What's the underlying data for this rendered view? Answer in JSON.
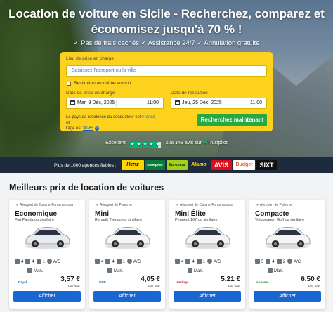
{
  "hero": {
    "title": "Location de voiture en Sicile - Recherchez, comparez et économisez jusqu'à 70 % !",
    "features": "✓ Pas de frais cachés ✓ Assistance 24/7 ✓ Annulation gratuite"
  },
  "form": {
    "pickup_label": "Lieu de prise en charge",
    "pickup_placeholder": "Saisissez l'aéroport ou la ville",
    "same_return_label": "Restitution au même endroit",
    "start_label": "Date de prise en charge",
    "start_date": "Mar, 9 Déc, 2025",
    "start_time": "11:00",
    "end_label": "Date de restitution",
    "end_date": "Jeu, 25 Déc, 2025",
    "end_time": "11:00",
    "residence_text": "Le pays de résidence du conducteur est",
    "residence_country": "France",
    "residence_and": "et",
    "age_text": "l'âge est",
    "age_value": "30-65",
    "search_button": "Recherchez maintenant"
  },
  "trust": {
    "rating_word": "Excellent",
    "reviews": "206 148 avis sur",
    "brand": "Trustpilot",
    "stars": 4.5
  },
  "partners": {
    "label": "Plus de 1000 agences fiables :",
    "brands": [
      "Hertz",
      "Enterprise",
      "Europcar",
      "Alamo",
      "AVIS",
      "Budget",
      "SIXT"
    ]
  },
  "section_title": "Meilleurs prix de location de voitures",
  "cards": [
    {
      "location": "Aéroport de Catane-Fontanarossa",
      "category": "Economique",
      "model": "Fiat Panda ou similaire",
      "seats": "4",
      "doors": "4",
      "bags": "1",
      "ac": "A/C",
      "transmission": "Man.",
      "supplier": "Royal",
      "price": "3,57 €",
      "per": "par jour",
      "button": "Afficher",
      "car_color": "#e8ecef"
    },
    {
      "location": "Aéroport de Palerme",
      "category": "Mini",
      "model": "Renault Twingo ou similaire",
      "seats": "4",
      "doors": "4",
      "bags": "1",
      "ac": "A/C",
      "transmission": "Man.",
      "supplier": "ECR",
      "price": "4,05 €",
      "per": "par jour",
      "button": "Afficher",
      "car_color": "#f4f5f7"
    },
    {
      "location": "Aéroport de Catane-Fontanarossa",
      "category": "Mini Élite",
      "model": "Peugeot 107 ou similaire",
      "seats": "4",
      "doors": "4",
      "bags": "1",
      "ac": "A/C",
      "transmission": "Man.",
      "supplier": "Caringo",
      "price": "5,21 €",
      "per": "par jour",
      "button": "Afficher",
      "car_color": "#f2f3f5"
    },
    {
      "location": "Aéroport de Palerme",
      "category": "Compacte",
      "model": "Volkswagen Golf ou similaire",
      "seats": "5",
      "doors": "4",
      "bags": "2",
      "ac": "A/C",
      "transmission": "Man.",
      "supplier": "Locauto",
      "price": "6,50 €",
      "per": "par jour",
      "button": "Afficher",
      "car_color": "#f4f5f7"
    }
  ]
}
